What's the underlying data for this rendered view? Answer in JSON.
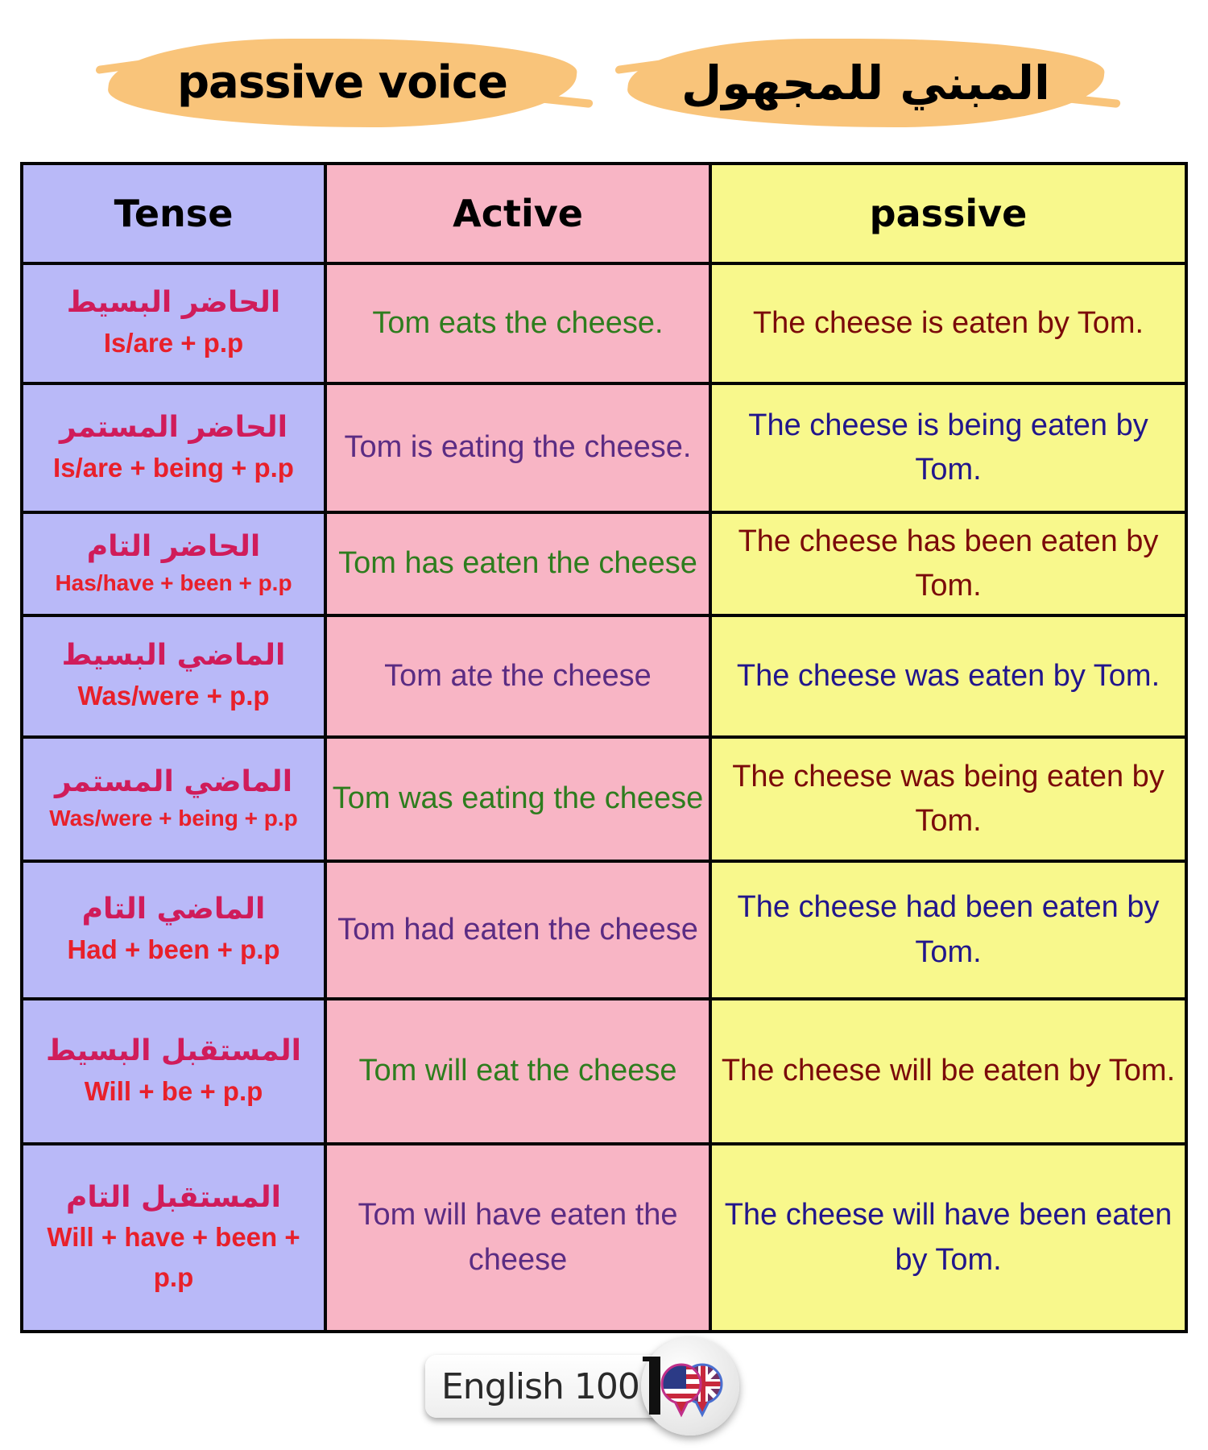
{
  "header": {
    "title_en": "passive voice",
    "title_ar": "المبني للمجهول",
    "brush_color": "#f9c47a"
  },
  "table": {
    "columns": [
      "Tense",
      "Active",
      "passive"
    ],
    "colors": {
      "tense_bg": "#b9b9f8",
      "active_bg": "#f8b5c5",
      "passive_bg": "#f8f88c",
      "arabic_text": "#d01c5a",
      "formula_text": "#e8202a"
    },
    "rows": [
      {
        "tense_ar": "الحاضر البسيط",
        "formula": "Is/are + p.p",
        "active": "Tom eats the cheese.",
        "active_color": "#2e7d1e",
        "passive": "The cheese is eaten by Tom.",
        "passive_color": "#7b0a0a"
      },
      {
        "tense_ar": "الحاضر المستمر",
        "formula": "Is/are + being + p.p",
        "active": "Tom is eating the cheese.",
        "active_color": "#5b2c83",
        "passive": "The cheese is being eaten by Tom.",
        "passive_color": "#22168c"
      },
      {
        "tense_ar": "الحاضر التام",
        "formula": "Has/have + been + p.p",
        "active": "Tom has eaten the cheese",
        "active_color": "#2e7d1e",
        "passive": "The cheese has been eaten by Tom.",
        "passive_color": "#7b0a0a"
      },
      {
        "tense_ar": "الماضي البسيط",
        "formula": "Was/were + p.p",
        "active": "Tom ate the cheese",
        "active_color": "#5b2c83",
        "passive": "The cheese was eaten by Tom.",
        "passive_color": "#22168c"
      },
      {
        "tense_ar": "الماضي المستمر",
        "formula": "Was/were + being + p.p",
        "active": "Tom was eating the cheese",
        "active_color": "#2e7d1e",
        "passive": "The cheese was being eaten by Tom.",
        "passive_color": "#7b0a0a"
      },
      {
        "tense_ar": "الماضي التام",
        "formula": "Had + been + p.p",
        "active": "Tom had eaten the cheese",
        "active_color": "#5b2c83",
        "passive": "The cheese had been eaten by Tom.",
        "passive_color": "#22168c"
      },
      {
        "tense_ar": "المستقبل البسيط",
        "formula": "Will + be + p.p",
        "active": "Tom will eat the cheese",
        "active_color": "#2e7d1e",
        "passive": "The cheese will be eaten by Tom.",
        "passive_color": "#7b0a0a"
      },
      {
        "tense_ar": "المستقبل التام",
        "formula": "Will + have + been + p.p",
        "active": "Tom will have eaten the cheese",
        "active_color": "#5b2c83",
        "passive": "The cheese will have been eaten by Tom.",
        "passive_color": "#22168c"
      }
    ]
  },
  "logo": {
    "text": "English 100",
    "icon": "us-uk-flag-speech-bubbles-icon"
  }
}
